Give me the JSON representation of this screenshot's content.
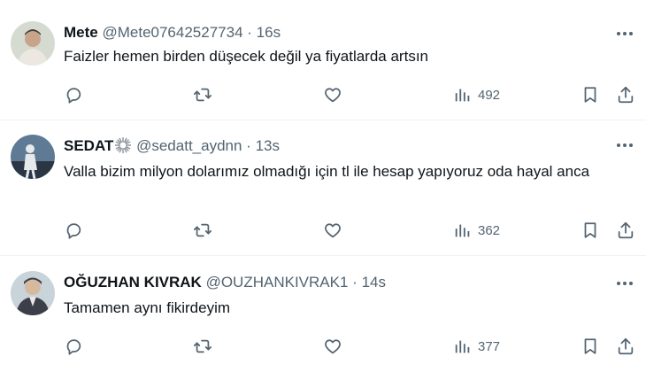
{
  "tweets": [
    {
      "name": "Mete",
      "handle": "@Mete07642527734",
      "separator": "·",
      "time": "16s",
      "text": "Faizler hemen birden düşecek değil ya fiyatlarda artsın",
      "views": "492",
      "avatar_colors": [
        "#cfd6cc",
        "#5b5248",
        "#e9e4dc"
      ]
    },
    {
      "name": "SEDAT",
      "handle": "@sedatt_aydnn",
      "separator": "·",
      "time": "13s",
      "text": "Valla bizim milyon dolarımız olmadığı için tl ile hesap yapıyoruz oda hayal anca",
      "views": "362",
      "avatar_colors": [
        "#3a5068",
        "#b9c7d4",
        "#1b2633"
      ]
    },
    {
      "name": "OĞUZHAN KIVRAK",
      "handle": "@OUZHANKIVRAK1",
      "separator": "·",
      "time": "14s",
      "text": "Tamamen aynı fikirdeyim",
      "views": "377",
      "avatar_colors": [
        "#c9d3da",
        "#3c3f47",
        "#d7b9a0"
      ]
    }
  ],
  "icons": {
    "more": "more-icon",
    "reply": "reply-icon",
    "retweet": "retweet-icon",
    "like": "heart-icon",
    "views": "views-icon",
    "bookmark": "bookmark-icon",
    "share": "share-icon",
    "badge": "sunburst-badge-icon"
  },
  "colors": {
    "text": "#0f1419",
    "secondary": "#536471",
    "divider": "#eff3f4",
    "background": "#ffffff"
  }
}
